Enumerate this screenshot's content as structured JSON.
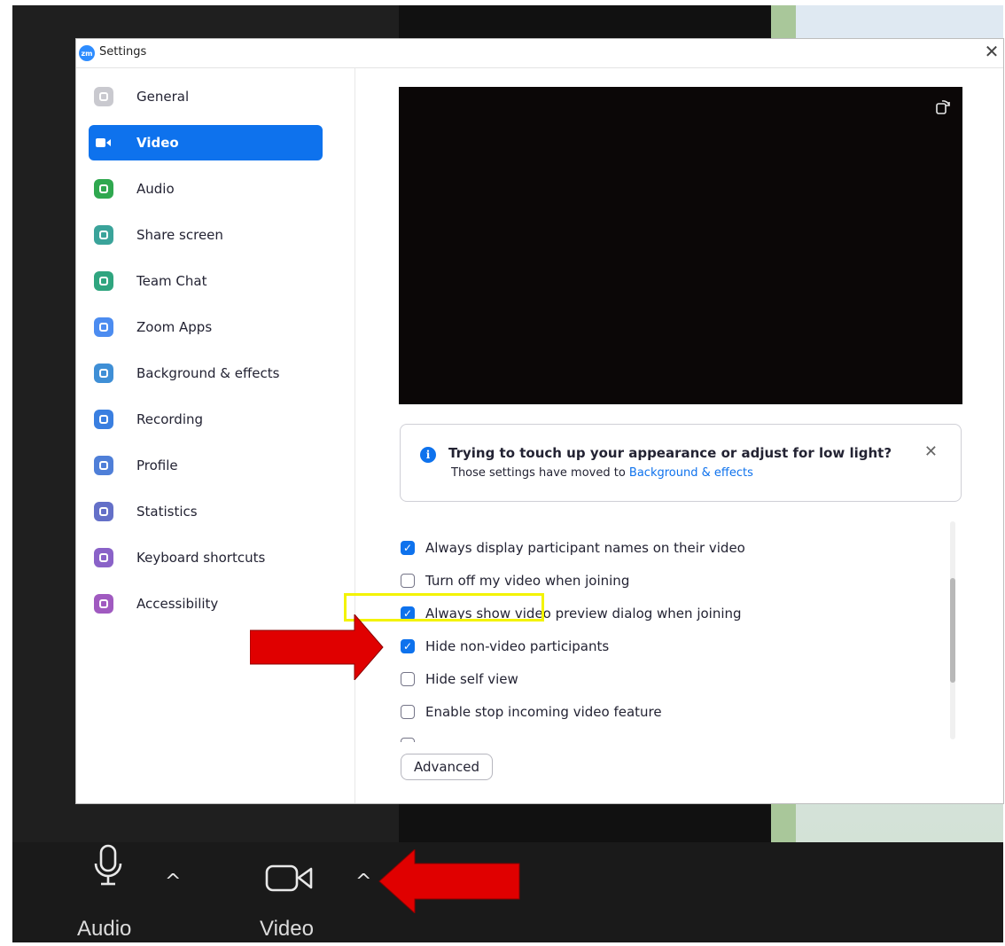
{
  "window": {
    "title": "Settings",
    "logo_text": "zm",
    "close_glyph": "✕"
  },
  "sidebar": {
    "items": [
      {
        "label": "General",
        "icon": "gear-icon",
        "color": "#c9c9cf",
        "active": false
      },
      {
        "label": "Video",
        "icon": "video-camera-icon",
        "color": "#0e72ed",
        "active": true
      },
      {
        "label": "Audio",
        "icon": "headphones-icon",
        "color": "#2fa84f",
        "active": false
      },
      {
        "label": "Share screen",
        "icon": "share-screen-icon",
        "color": "#3aa39a",
        "active": false
      },
      {
        "label": "Team Chat",
        "icon": "chat-icon",
        "color": "#2fa57f",
        "active": false
      },
      {
        "label": "Zoom Apps",
        "icon": "apps-icon",
        "color": "#4c8cf0",
        "active": false
      },
      {
        "label": "Background & effects",
        "icon": "background-icon",
        "color": "#3f8fd6",
        "active": false
      },
      {
        "label": "Recording",
        "icon": "record-icon",
        "color": "#3a7fe0",
        "active": false
      },
      {
        "label": "Profile",
        "icon": "profile-icon",
        "color": "#4f7fd8",
        "active": false
      },
      {
        "label": "Statistics",
        "icon": "statistics-icon",
        "color": "#6470c8",
        "active": false
      },
      {
        "label": "Keyboard shortcuts",
        "icon": "keyboard-icon",
        "color": "#8a62c8",
        "active": false
      },
      {
        "label": "Accessibility",
        "icon": "accessibility-icon",
        "color": "#a05ac0",
        "active": false
      }
    ]
  },
  "notice": {
    "title": "Trying to touch up your appearance or adjust for low light?",
    "body_prefix": "Those settings have moved to ",
    "body_link": "Background & effects",
    "close_glyph": "✕"
  },
  "options": [
    {
      "label": "Always display participant names on their video",
      "checked": true
    },
    {
      "label": "Turn off my video when joining",
      "checked": false
    },
    {
      "label": "Always show video preview dialog when joining",
      "checked": true
    },
    {
      "label": "Hide non-video participants",
      "checked": true
    },
    {
      "label": "Hide self view",
      "checked": false
    },
    {
      "label": "Enable stop incoming video feature",
      "checked": false
    },
    {
      "label": "",
      "checked": false
    }
  ],
  "advanced_label": "Advanced",
  "toolbar": {
    "audio_label": "Audio",
    "video_label": "Video",
    "caret_glyph": "^"
  },
  "colors": {
    "accent": "#0e72ed",
    "highlight": "#f3f300",
    "annotation_arrow": "#e00000"
  }
}
